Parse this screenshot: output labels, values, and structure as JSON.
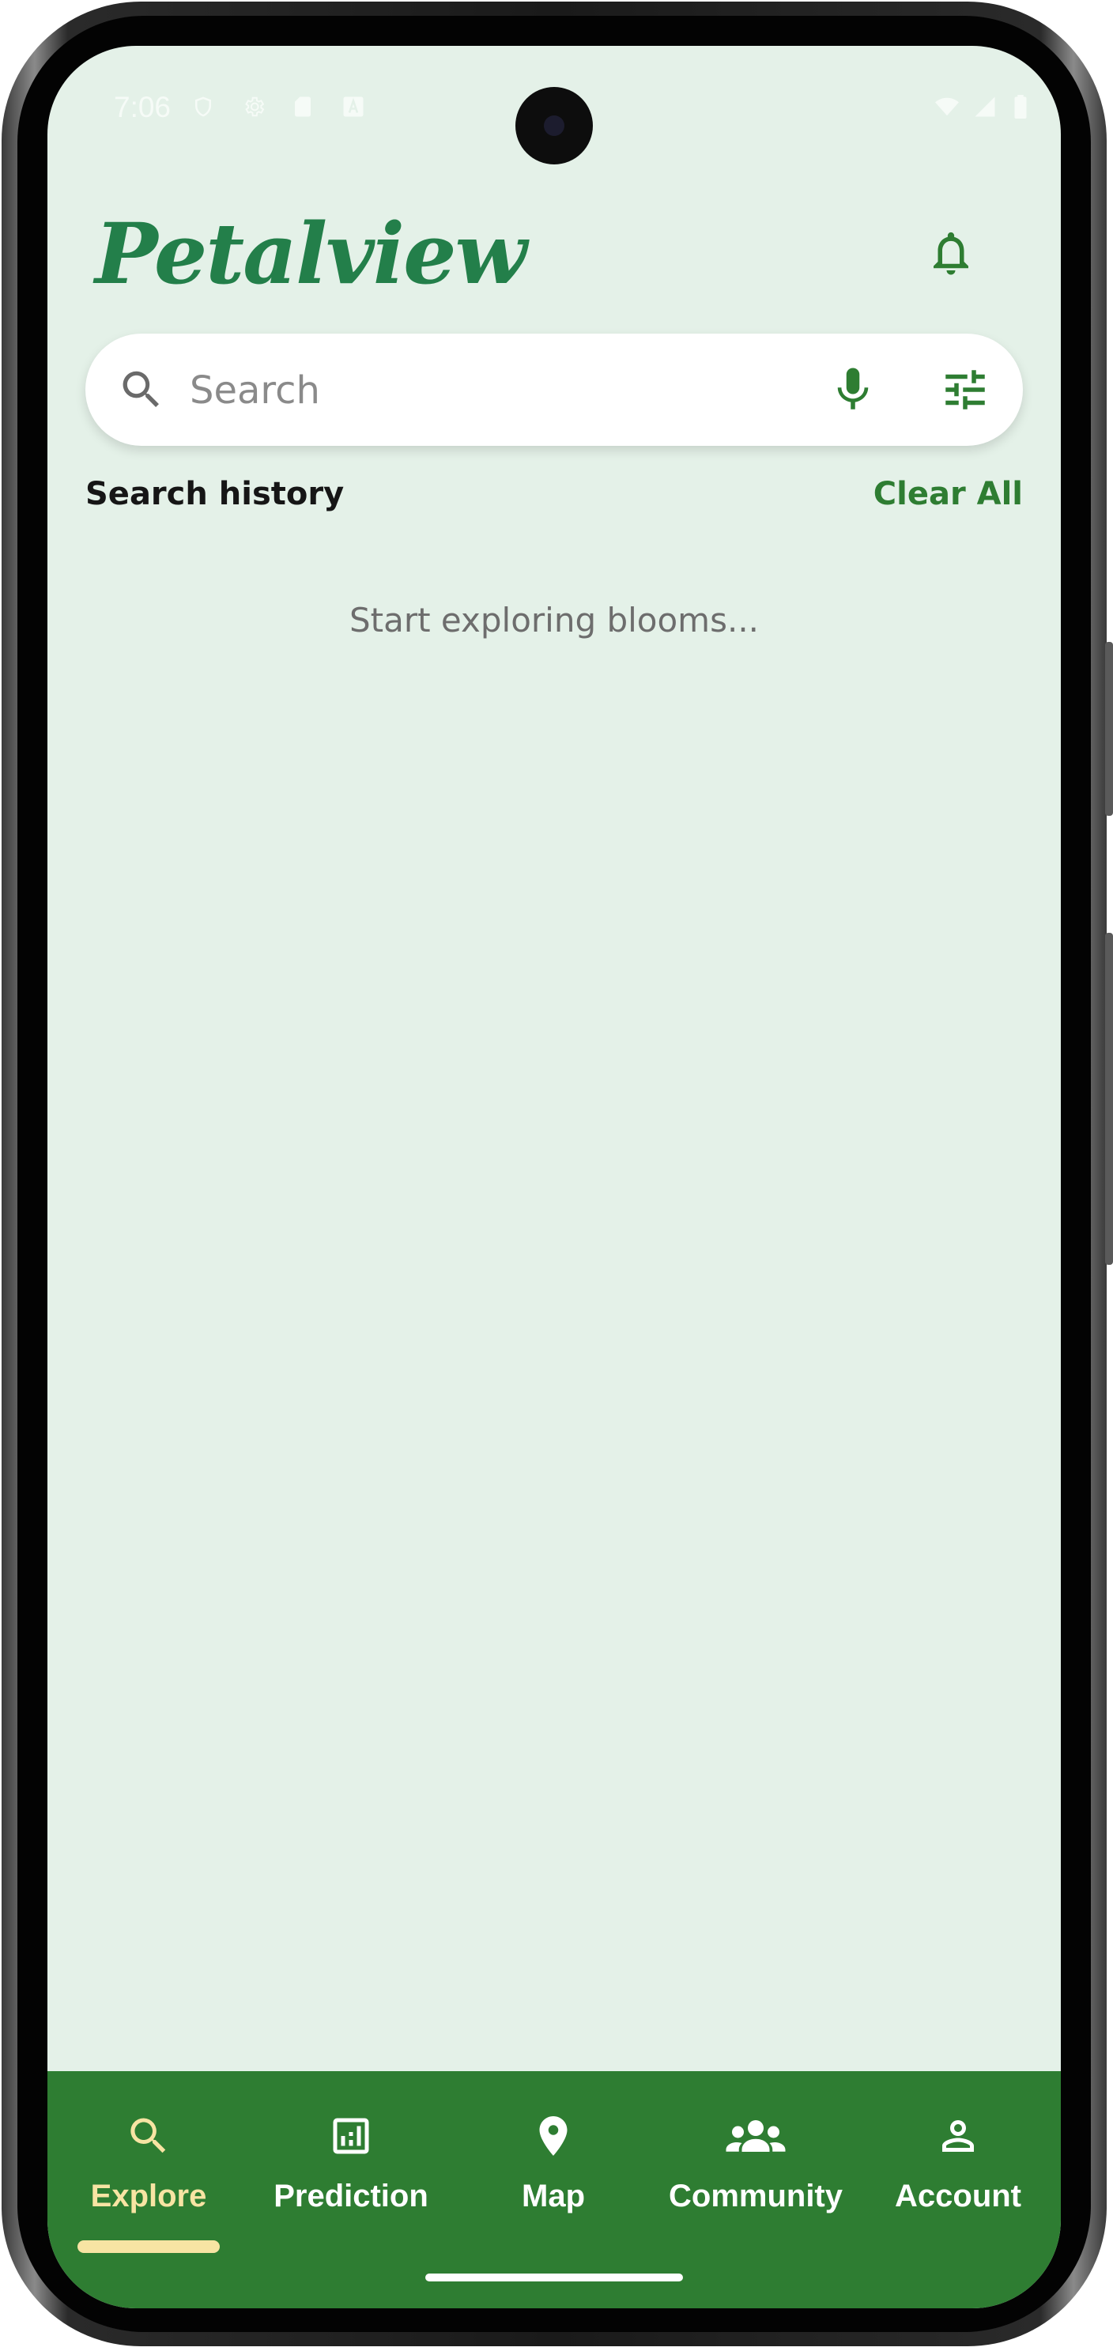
{
  "status_bar": {
    "time": "7:06"
  },
  "header": {
    "logo_text": "Petalview"
  },
  "search": {
    "placeholder": "Search"
  },
  "history": {
    "title": "Search history",
    "clear_label": "Clear All",
    "empty_message": "Start exploring blooms..."
  },
  "bottom_nav": {
    "active": "Explore",
    "items": [
      {
        "label": "Explore",
        "icon": "search-icon"
      },
      {
        "label": "Prediction",
        "icon": "chart-icon"
      },
      {
        "label": "Map",
        "icon": "map-pin-icon"
      },
      {
        "label": "Community",
        "icon": "people-icon"
      },
      {
        "label": "Account",
        "icon": "person-icon"
      }
    ]
  },
  "colors": {
    "brand_green": "#2e7d32",
    "logo_green": "#237f4a",
    "background": "#e4f1e8",
    "active_tab": "#f7e4a3"
  }
}
